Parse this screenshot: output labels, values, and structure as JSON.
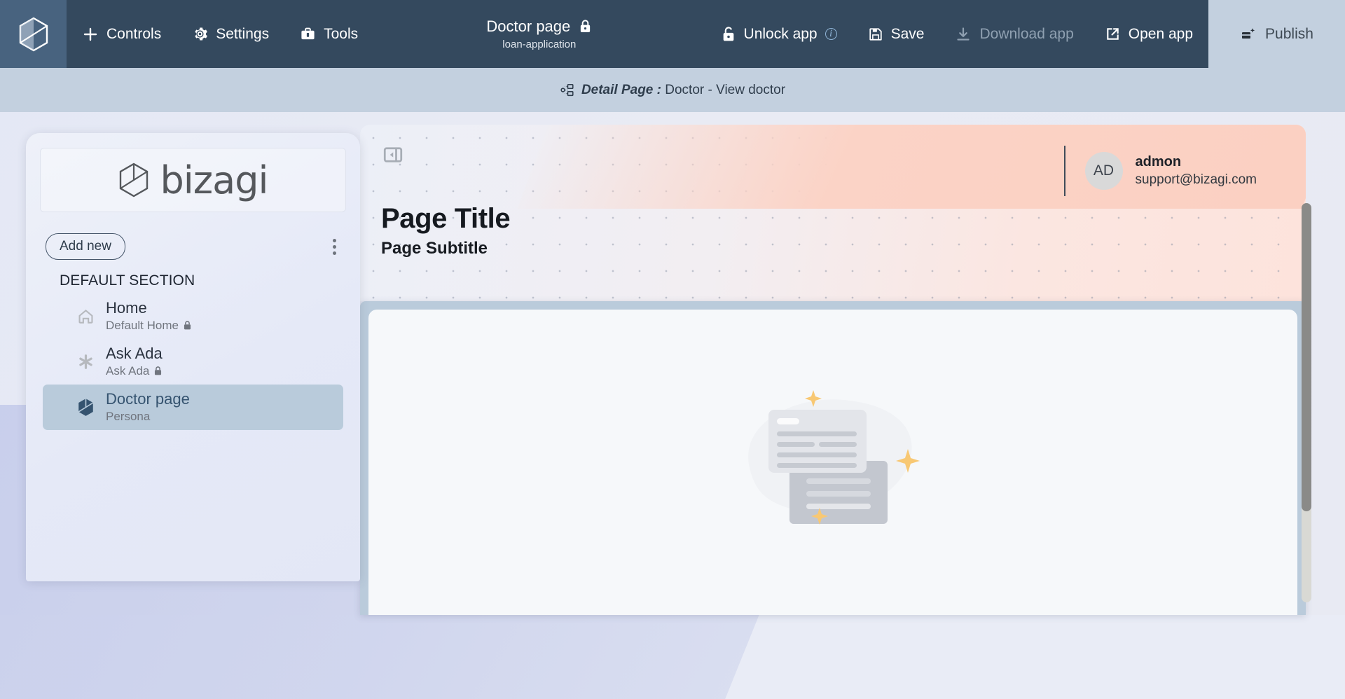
{
  "topbar": {
    "logo_icon": "bizagi-cube-icon",
    "items": [
      {
        "label": "Controls",
        "icon": "plus-icon",
        "disabled": false
      },
      {
        "label": "Settings",
        "icon": "gear-icon",
        "disabled": false
      },
      {
        "label": "Tools",
        "icon": "toolbox-icon",
        "disabled": false
      }
    ],
    "page": {
      "title": "Doctor page",
      "subtitle": "loan-application",
      "lock_icon": "lock-closed-icon"
    },
    "actions": [
      {
        "label": "Unlock app",
        "icon": "lock-open-icon",
        "disabled": false,
        "info": true
      },
      {
        "label": "Save",
        "icon": "floppy-disk-icon",
        "disabled": false,
        "info": false
      },
      {
        "label": "Download app",
        "icon": "download-icon",
        "disabled": true,
        "info": false
      },
      {
        "label": "Open app",
        "icon": "external-link-icon",
        "disabled": false,
        "info": false
      }
    ],
    "publish": {
      "label": "Publish",
      "icon": "publish-icon"
    },
    "colors": {
      "bar": "#34495e",
      "brand_tile": "#48637f",
      "publish_bg": "#c3d0df"
    }
  },
  "breadcrumb": {
    "icon": "sitemap-icon",
    "prefix": "Detail Page :",
    "text": "Doctor - View doctor",
    "bg": "#c3d0df"
  },
  "left_panel": {
    "logo_text": "bizagi",
    "logo_icon": "bizagi-cube-icon",
    "add_new_label": "Add new",
    "kebab_icon": "kebab-menu-icon",
    "section_label": "DEFAULT SECTION",
    "items": [
      {
        "title": "Home",
        "subtitle": "Default Home",
        "icon": "home-icon",
        "locked": true,
        "active": false
      },
      {
        "title": "Ask Ada",
        "subtitle": "Ask Ada",
        "icon": "asterisk-icon",
        "locked": true,
        "active": false
      },
      {
        "title": "Doctor page",
        "subtitle": "Persona",
        "icon": "bizagi-cube-icon",
        "locked": false,
        "active": true
      }
    ],
    "active_bg": "#b9cbdb"
  },
  "canvas": {
    "collapse_icon": "panel-collapse-icon",
    "user": {
      "initials": "AD",
      "name": "admon",
      "email": "support@bizagi.com",
      "avatar_bg": "#d9d9d9"
    },
    "page_title": "Page Title",
    "page_subtitle": "Page Subtitle",
    "empty_illustration": "documents-placeholder-illustration",
    "accent_peach": "#fbd0c2",
    "frame_border": "#bacbdb",
    "card_bg": "#f6f8fa"
  },
  "scrollbar": {
    "name": "vertical-scrollbar",
    "track": "#d9d9d4",
    "thumb": "#8a8a88"
  }
}
